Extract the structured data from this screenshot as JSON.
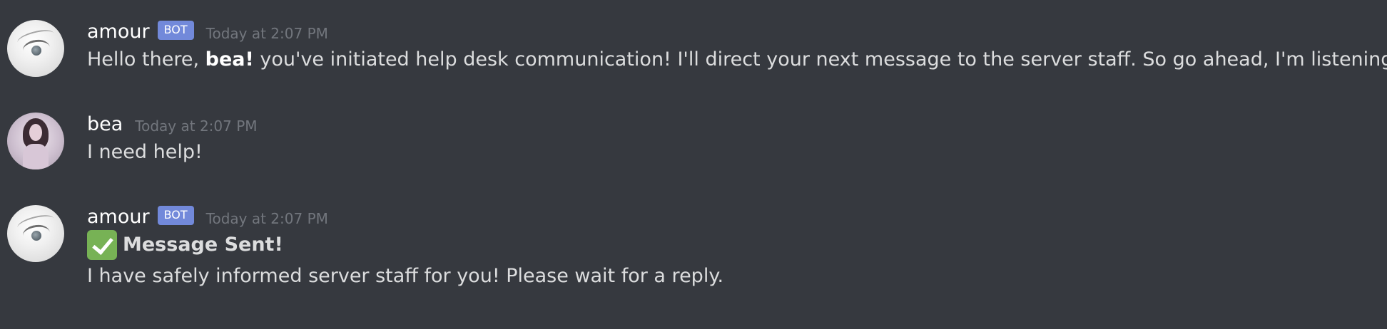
{
  "messages": [
    {
      "author": "amour",
      "badge": "BOT",
      "timestamp": "Today at 2:07 PM",
      "text_before": "Hello there,",
      "mention_bold": "bea!",
      "text_after": "you've initiated help desk communication! I'll direct your next message to the server staff. So go ahead, I'm listening!"
    },
    {
      "author": "bea",
      "timestamp": "Today at 2:07 PM",
      "text": "I need help!"
    },
    {
      "author": "amour",
      "badge": "BOT",
      "timestamp": "Today at 2:07 PM",
      "icon": "white-check-mark-icon",
      "title": "Message Sent!",
      "text": "I have safely informed server staff for you! Please wait for a reply."
    }
  ],
  "colors": {
    "background": "#36393f",
    "bot_badge": "#7289da",
    "timestamp": "#72767d",
    "message_text": "#dcddde",
    "check_green": "#77b255"
  }
}
